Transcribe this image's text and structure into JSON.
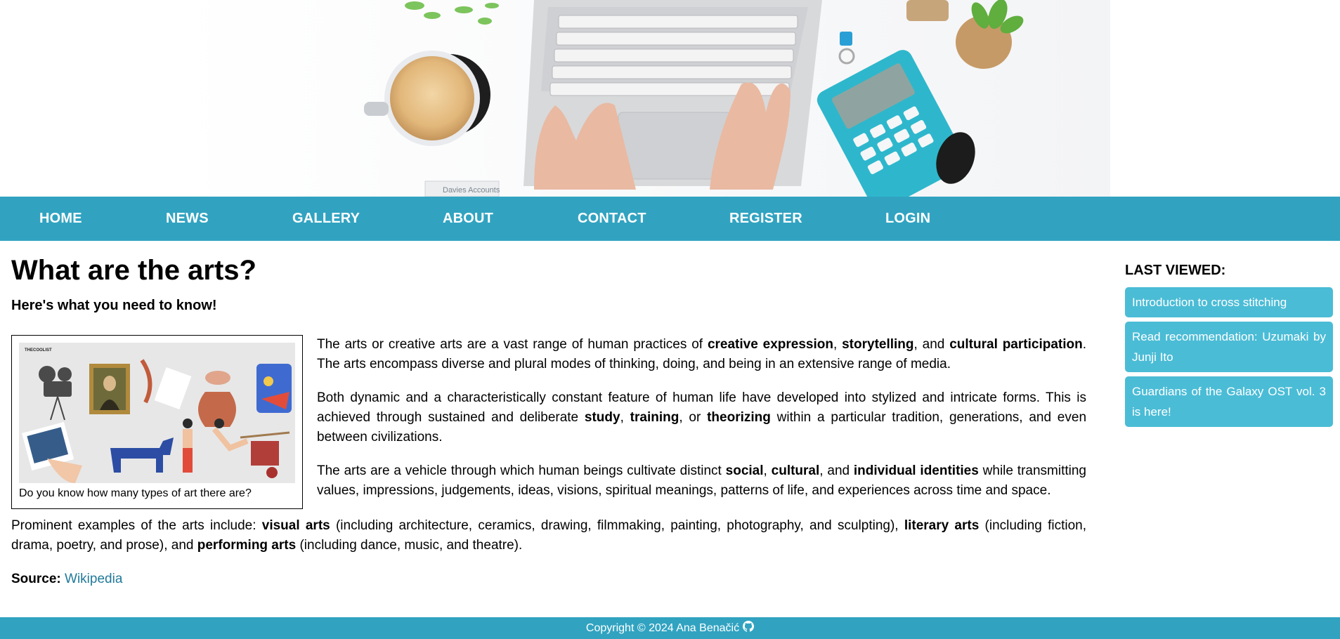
{
  "nav": {
    "items": [
      "HOME",
      "NEWS",
      "GALLERY",
      "ABOUT",
      "CONTACT",
      "REGISTER",
      "LOGIN"
    ]
  },
  "hero": {
    "watermark": "Davies Accounts"
  },
  "article": {
    "title": "What are the arts?",
    "subtitle": "Here's what you need to know!",
    "figure": {
      "brand": "THECOOLIST",
      "caption": "Do you know how many types of art there are?"
    },
    "p1": {
      "t1": "The arts or creative arts are a vast range of human practices of ",
      "b1": "creative expression",
      "t2": ", ",
      "b2": "storytelling",
      "t3": ", and ",
      "b3": "cultural participation",
      "t4": ". The arts encompass diverse and plural modes of thinking, doing, and being in an extensive range of media."
    },
    "p2": {
      "t1": "Both dynamic and a characteristically constant feature of human life have developed into stylized and intricate forms. This is achieved through sustained and deliberate ",
      "b1": "study",
      "t2": ", ",
      "b2": "training",
      "t3": ", or ",
      "b3": "theorizing",
      "t4": " within a particular tradition, generations, and even between civilizations."
    },
    "p3": {
      "t1": "The arts are a vehicle through which human beings cultivate distinct ",
      "b1": "social",
      "t2": ", ",
      "b2": "cultural",
      "t3": ", and ",
      "b3": "individual identities",
      "t4": " while transmitting values, impressions, judgements, ideas, visions, spiritual meanings, patterns of life, and experiences across time and space."
    },
    "p4": {
      "t1": "Prominent examples of the arts include: ",
      "b1": "visual arts",
      "t2": " (including architecture, ceramics, drawing, filmmaking, painting, photography, and sculpting), ",
      "b2": "literary arts",
      "t3": " (including fiction, drama, poetry, and prose), and ",
      "b3": "performing arts",
      "t4": " (including dance, music, and theatre)."
    },
    "source": {
      "label": "Source:",
      "link": "Wikipedia"
    }
  },
  "sidebar": {
    "heading": "LAST VIEWED:",
    "items": [
      "Introduction to cross stitching",
      "Read recommendation: Uzumaki by Junji Ito",
      "Guardians of the Galaxy OST vol. 3 is here!"
    ]
  },
  "footer": {
    "text": "Copyright © 2024 Ana Benačić"
  },
  "colors": {
    "nav": "#31a3c1",
    "sidebar_item": "#4bbcd6",
    "link": "#217a9a"
  }
}
